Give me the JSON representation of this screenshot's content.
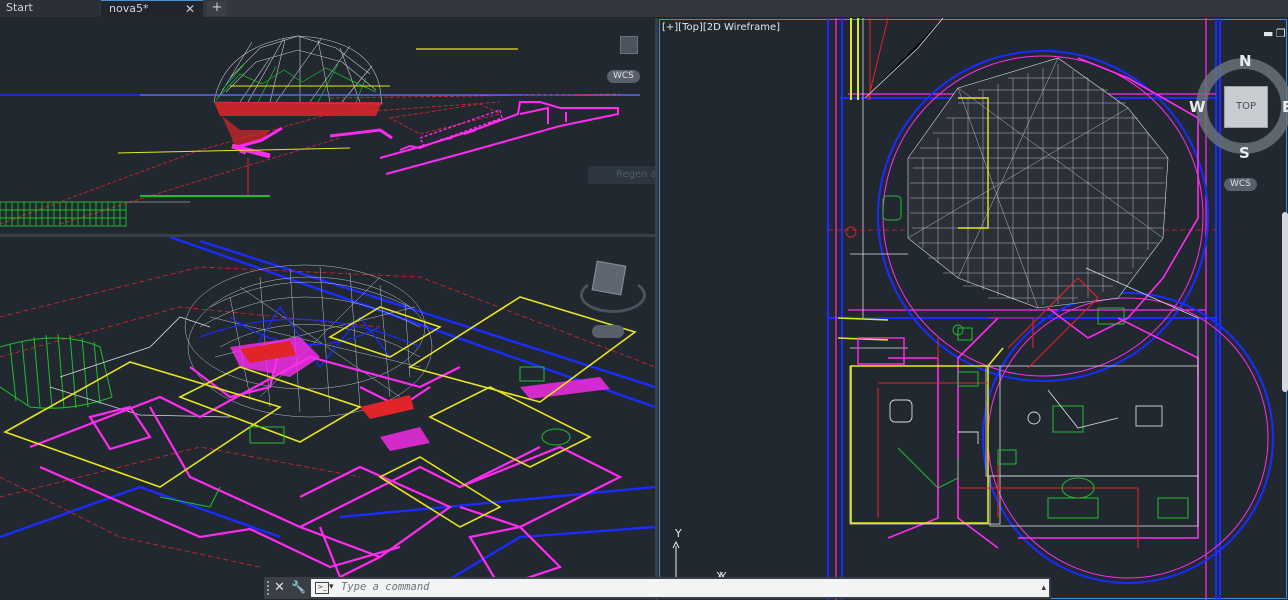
{
  "tabs": [
    {
      "label": "Start"
    },
    {
      "label": "nova5*"
    }
  ],
  "tab_close": "✕",
  "tab_new": "+",
  "viewports": {
    "top": {
      "label": "[+][Top][2D Wireframe]"
    },
    "front": {
      "wcs": "WCS",
      "tooltip": "Regen at Tile Chain"
    },
    "perspective": {}
  },
  "viewcube": {
    "face": "TOP",
    "north": "N",
    "south": "S",
    "west": "W",
    "east": "E",
    "wcs": "WCS"
  },
  "window_controls": {
    "minimize": "▬",
    "restore": "❐"
  },
  "ucs": {
    "x": "X",
    "y": "Y"
  },
  "command_line": {
    "placeholder": "Type a command",
    "close": "✕",
    "customize": "🔧"
  },
  "colors": {
    "magenta": "#ff2cf0",
    "blue": "#1a2cff",
    "red": "#e0242a",
    "yellow": "#e6e61e",
    "green": "#1fbf2a",
    "white": "#d8dbe0",
    "accent": "#3c8fdc"
  }
}
